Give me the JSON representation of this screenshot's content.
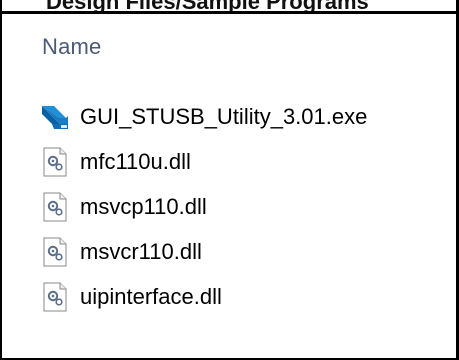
{
  "window": {
    "clipped_heading": "Design Files/Sample Programs"
  },
  "list": {
    "column_header": "Name",
    "items": [
      {
        "name": "GUI_STUSB_Utility_3.01.exe",
        "icon": "application-exe-icon"
      },
      {
        "name": "mfc110u.dll",
        "icon": "dll-file-icon"
      },
      {
        "name": "msvcp110.dll",
        "icon": "dll-file-icon"
      },
      {
        "name": "msvcr110.dll",
        "icon": "dll-file-icon"
      },
      {
        "name": "uipinterface.dll",
        "icon": "dll-file-icon"
      }
    ]
  },
  "colors": {
    "header_text": "#4a5a78",
    "exe_icon_primary": "#1e8fd8",
    "exe_icon_accent": "#0b5fa5",
    "dll_gear": "#5a6e8c"
  }
}
